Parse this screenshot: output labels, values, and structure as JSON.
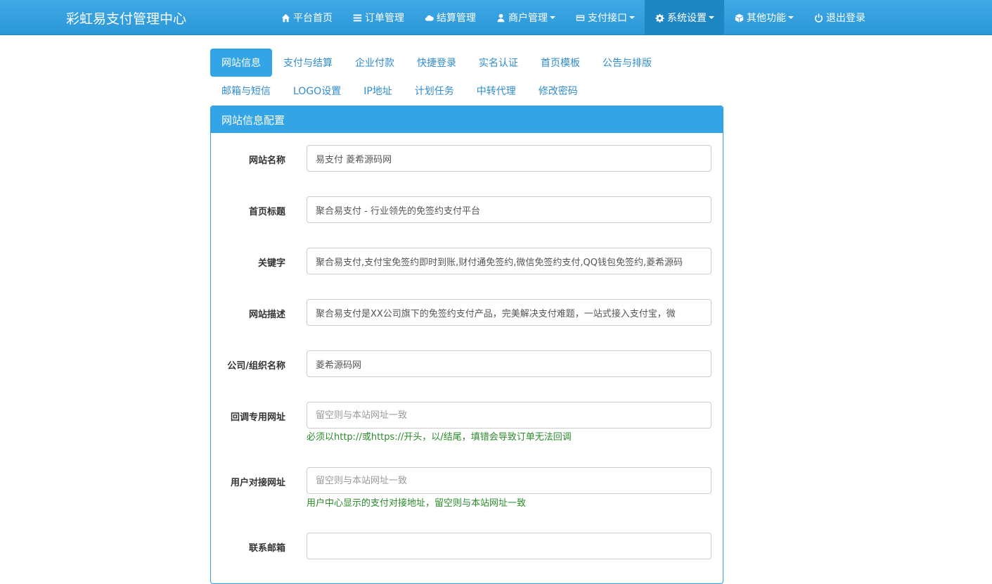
{
  "navbar": {
    "brand": "彩虹易支付管理中心",
    "items": [
      {
        "label": "平台首页",
        "icon": "home-icon"
      },
      {
        "label": "订单管理",
        "icon": "list-icon"
      },
      {
        "label": "结算管理",
        "icon": "cloud-icon"
      },
      {
        "label": "商户管理",
        "icon": "user-icon"
      },
      {
        "label": "支付接口",
        "icon": "credit-card-icon"
      },
      {
        "label": "系统设置",
        "icon": "gear-icon"
      },
      {
        "label": "其他功能",
        "icon": "cube-icon"
      },
      {
        "label": "退出登录",
        "icon": "power-icon"
      }
    ]
  },
  "tabs": {
    "row1": [
      "网站信息",
      "支付与结算",
      "企业付款",
      "快捷登录",
      "实名认证",
      "首页模板",
      "公告与排版"
    ],
    "row2": [
      "邮箱与短信",
      "LOGO设置",
      "IP地址",
      "计划任务",
      "中转代理",
      "修改密码"
    ]
  },
  "panel": {
    "title": "网站信息配置",
    "fields": [
      {
        "label": "网站名称",
        "value": "易支付 菱希源码网",
        "placeholder": ""
      },
      {
        "label": "首页标题",
        "value": "聚合易支付 - 行业领先的免签约支付平台",
        "placeholder": ""
      },
      {
        "label": "关键字",
        "value": "聚合易支付,支付宝免签约即时到账,财付通免签约,微信免签约支付,QQ钱包免签约,菱希源码",
        "placeholder": ""
      },
      {
        "label": "网站描述",
        "value": "聚合易支付是XX公司旗下的免签约支付产品，完美解决支付难题，一站式接入支付宝，微",
        "placeholder": ""
      },
      {
        "label": "公司/组织名称",
        "value": "菱希源码网",
        "placeholder": ""
      },
      {
        "label": "回调专用网址",
        "value": "",
        "placeholder": "留空则与本站网址一致",
        "help": "必须以http://或https://开头，以/结尾，填错会导致订单无法回调"
      },
      {
        "label": "用户对接网址",
        "value": "",
        "placeholder": "留空则与本站网址一致",
        "help": "用户中心显示的支付对接地址，留空则与本站网址一致"
      },
      {
        "label": "联系邮箱",
        "value": "",
        "placeholder": ""
      }
    ]
  }
}
